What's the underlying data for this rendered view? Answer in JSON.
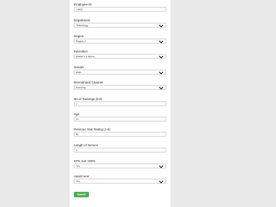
{
  "form": {
    "fields": [
      {
        "label": "Employee ID",
        "value": "14633",
        "type": "input"
      },
      {
        "label": "Department",
        "value": "Technology",
        "type": "select"
      },
      {
        "label": "Region",
        "value": "Region_7",
        "type": "select"
      },
      {
        "label": "Education",
        "value": "Master's & above",
        "type": "select"
      },
      {
        "label": "Gender",
        "value": "Male",
        "type": "select"
      },
      {
        "label": "Recruitment Channel",
        "value": "Sourcing",
        "type": "select"
      },
      {
        "label": "No of Trainings (0-9)",
        "value": "1",
        "type": "input"
      },
      {
        "label": "Age",
        "value": "31",
        "type": "input"
      },
      {
        "label": "Previous Year Rating (1-5)",
        "value": "80",
        "type": "input"
      },
      {
        "label": "Length of Service",
        "value": "5",
        "type": "input"
      },
      {
        "label": "KPIs met >80%",
        "value": "Yes",
        "type": "select"
      },
      {
        "label": "Award won",
        "value": "Yes",
        "type": "select"
      }
    ],
    "submit_label": "Submit"
  },
  "icons": {
    "select_arrow": "chevron-down-icon"
  },
  "colors": {
    "submit": "#49b34a",
    "background": "#e9e9e9",
    "panel": "#ffffff"
  }
}
